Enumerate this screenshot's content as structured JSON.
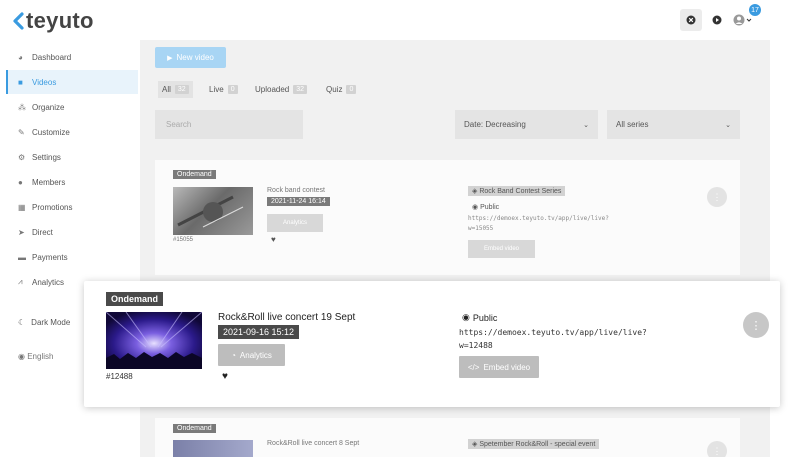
{
  "header": {
    "brand": "teyuto",
    "notification_count": "17",
    "icons": [
      "close-icon",
      "play-icon",
      "avatar-icon"
    ]
  },
  "sidebar": {
    "items": [
      {
        "label": "Dashboard",
        "icon": "dashboard-icon"
      },
      {
        "label": "Videos",
        "icon": "video-camera-icon",
        "active": true
      },
      {
        "label": "Organize",
        "icon": "hierarchy-icon"
      },
      {
        "label": "Customize",
        "icon": "brush-icon"
      },
      {
        "label": "Settings",
        "icon": "gears-icon"
      },
      {
        "label": "Members",
        "icon": "users-icon"
      },
      {
        "label": "Promotions",
        "icon": "building-icon"
      },
      {
        "label": "Direct",
        "icon": "paper-plane-icon"
      },
      {
        "label": "Payments",
        "icon": "wallet-icon"
      },
      {
        "label": "Analytics",
        "icon": "chart-line-icon"
      }
    ],
    "dark_mode": "Dark Mode",
    "language": "English"
  },
  "toolbar": {
    "new_video": "New video",
    "tabs": [
      {
        "label": "All",
        "count": "32",
        "active": true
      },
      {
        "label": "Live",
        "count": "0"
      },
      {
        "label": "Uploaded",
        "count": "32"
      },
      {
        "label": "Quiz",
        "count": "0"
      }
    ],
    "search_placeholder": "Search",
    "sort_value": "Date: Decreasing",
    "series_value": "All series"
  },
  "videos": [
    {
      "type": "Ondemand",
      "title": "Rock band contest",
      "date": "2021-11-24 16:14",
      "id": "#15055",
      "analytics": "Analytics",
      "series": "Rock Band Contest Series",
      "visibility": "Public",
      "url_line1": "https://demoex.teyuto.tv/app/live/live?",
      "url_line2": "w=15055",
      "embed": "Embed video"
    },
    {
      "type": "Ondemand",
      "title": "Rock&Roll live concert 19 Sept",
      "date": "2021-09-16 15:12",
      "id": "#12488",
      "analytics": "Analytics",
      "visibility": "Public",
      "url_line1": "https://demoex.teyuto.tv/app/live/live?",
      "url_line2": "w=12488",
      "embed": "Embed video"
    },
    {
      "type": "Ondemand",
      "title": "Rock&Roll live concert 8 Sept",
      "series": "Spetember Rock&Roll - special event"
    }
  ],
  "colors": {
    "accent": "#3a9be0",
    "new_button": "#a8d5f4",
    "dark_badge": "#4a4a4a"
  }
}
